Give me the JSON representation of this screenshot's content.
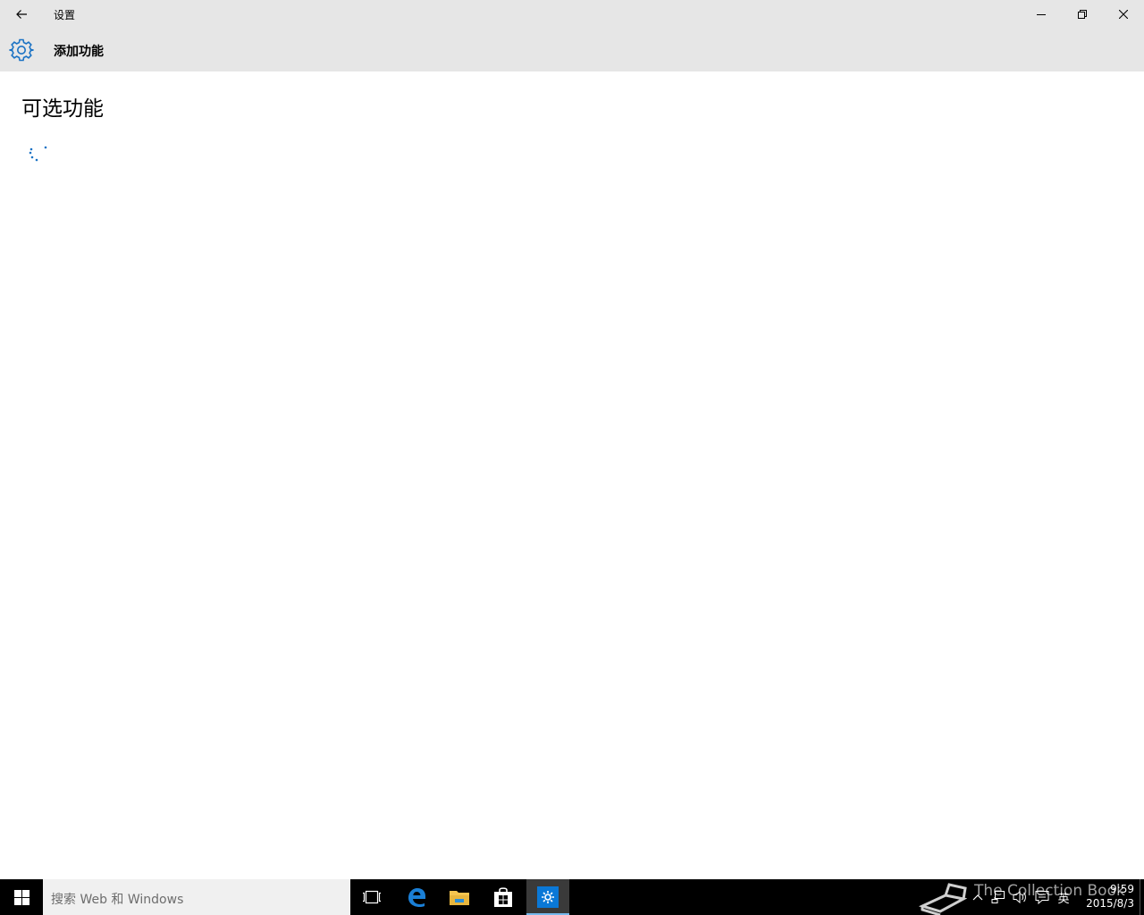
{
  "window": {
    "title": "设置",
    "back_icon": "back-arrow-icon",
    "minimize_icon": "minimize-icon",
    "maximize_icon": "restore-icon",
    "close_icon": "close-icon"
  },
  "header": {
    "icon": "gear-icon",
    "title": "添加功能",
    "accent_color": "#1a72c4"
  },
  "main": {
    "page_title": "可选功能",
    "loading_indicator": "loading-spinner-icon"
  },
  "taskbar": {
    "search_placeholder": "搜索 Web 和 Windows",
    "pinned": [
      "task-view-icon",
      "edge-icon",
      "file-explorer-icon",
      "store-icon",
      "settings-icon"
    ],
    "active_app": "settings-icon",
    "watermark": "The Collection Book",
    "ime": "英",
    "time": "9:59",
    "date": "2015/8/3"
  }
}
